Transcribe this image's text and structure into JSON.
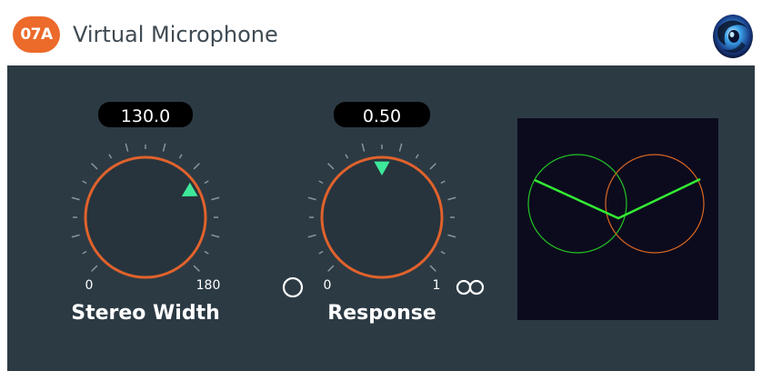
{
  "header": {
    "badge": "07A",
    "title": "Virtual Microphone",
    "logo_icon": "app-logo"
  },
  "knobs": [
    {
      "id": "stereo-width",
      "value_display": "130.0",
      "value": 130.0,
      "min_label": "0",
      "max_label": "180",
      "min": 0,
      "max": 180,
      "label": "Stereo Width"
    },
    {
      "id": "response",
      "value_display": "0.50",
      "value": 0.5,
      "min_label": "0",
      "max_label": "1",
      "min": 0,
      "max": 1,
      "label": "Response",
      "min_icon": "omni-circle-icon",
      "max_icon": "figure-eight-icon"
    }
  ],
  "polar_display": {
    "left_mic_color": "#22c422",
    "right_mic_color": "#d9661f",
    "line_color": "#33ee33",
    "background": "#0c0b1e"
  },
  "colors": {
    "badge": "#ec6a2a",
    "panel": "#2c3a44",
    "knob_ring": "#e0622c",
    "pointer": "#3ee89a",
    "value_box": "#000000"
  }
}
